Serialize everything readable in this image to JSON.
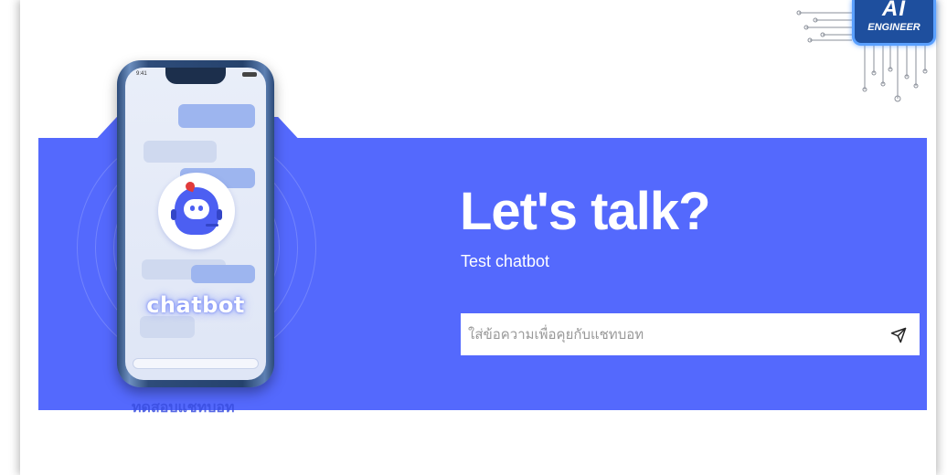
{
  "brand": {
    "logo_line1": "AI",
    "logo_line2": "ENGINEER",
    "icon": "circuit-chip-icon",
    "accent": "#1e4f9e"
  },
  "illustration": {
    "phone_status_time": "9:41",
    "logo_word": "chatbot",
    "caption": "ทดสอบแชทบอท",
    "icon": "chatbot-mascot-icon"
  },
  "hero": {
    "title": "Let's talk?",
    "subtitle": "Test chatbot",
    "background_color": "#5469fd"
  },
  "chat_input": {
    "value": "",
    "placeholder": "ใส่ข้อความเพื่อคุยกับแชทบอท"
  },
  "send_button": {
    "icon": "paper-plane-icon"
  }
}
